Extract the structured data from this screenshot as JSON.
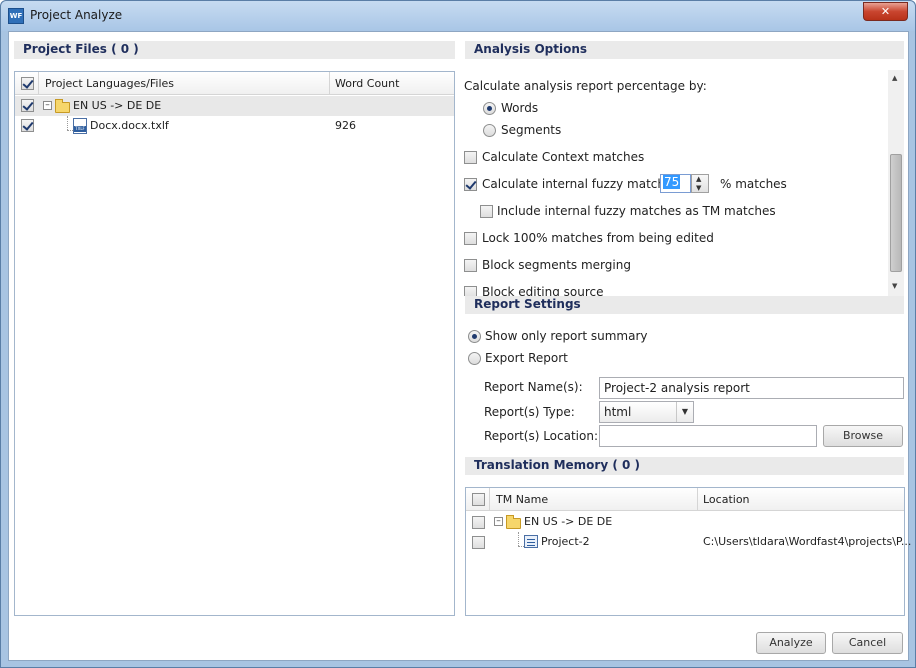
{
  "window": {
    "title": "Project Analyze",
    "icon_text": "WF",
    "close_glyph": "✕"
  },
  "project_files": {
    "header": "Project Files ( 0 )",
    "columns": [
      "Project Languages/Files",
      "Word Count"
    ],
    "rows": [
      {
        "label": "EN US -> DE DE",
        "checked": true,
        "type": "folder"
      },
      {
        "label": "Docx.docx.txlf",
        "word_count": "926",
        "checked": true,
        "type": "file",
        "file_badge": "TXLF"
      }
    ]
  },
  "analysis_options": {
    "header": "Analysis Options",
    "percentage_by_label": "Calculate analysis report percentage by:",
    "radio_words": "Words",
    "radio_segments": "Segments",
    "context_matches": "Calculate Context matches",
    "internal_fuzzy": "Calculate internal fuzzy matches",
    "fuzzy_value": "75",
    "fuzzy_suffix": "% matches",
    "include_internal_fuzzy": "Include internal fuzzy matches as TM matches",
    "lock_100": "Lock 100% matches from being edited",
    "block_merging": "Block segments merging",
    "block_editing_source": "Block editing source"
  },
  "report_settings": {
    "header": "Report Settings",
    "show_summary": "Show only report summary",
    "export_report": "Export Report",
    "name_label": "Report Name(s):",
    "name_value": "Project-2 analysis report",
    "type_label": "Report(s) Type:",
    "type_value": "html",
    "location_label": "Report(s) Location:",
    "location_value": "",
    "browse_label": "Browse"
  },
  "translation_memory": {
    "header": "Translation Memory ( 0 )",
    "columns": [
      "TM Name",
      "Location"
    ],
    "rows": [
      {
        "label": "EN US -> DE DE",
        "type": "folder"
      },
      {
        "label": "Project-2",
        "location": "C:\\Users\\tldara\\Wordfast4\\projects\\P...",
        "type": "tm"
      }
    ]
  },
  "footer": {
    "analyze_label": "Analyze",
    "cancel_label": "Cancel"
  }
}
